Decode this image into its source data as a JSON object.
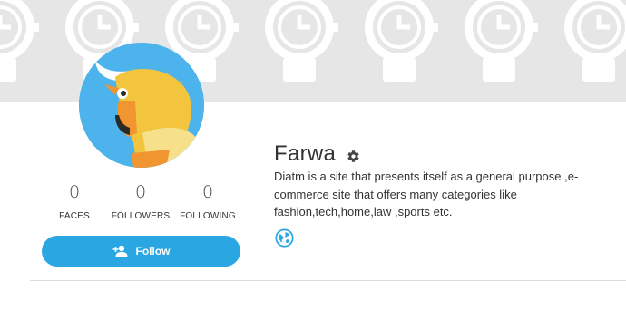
{
  "profile": {
    "name": "Farwa",
    "bio": "Diatm is a site that presents itself as a general purpose ,e-commerce site that offers many categories like fashion,tech,home,law ,sports etc."
  },
  "stats": [
    {
      "value": "0",
      "label": "FACES"
    },
    {
      "value": "0",
      "label": "FOLLOWERS"
    },
    {
      "value": "0",
      "label": "FOLLOWING"
    }
  ],
  "follow": {
    "label": "Follow",
    "icon": "add-person-icon"
  },
  "icons": {
    "settings": "gear-icon",
    "website": "globe-icon",
    "cover_pattern": "watch-icon"
  },
  "colors": {
    "accent": "#2aa7e3",
    "cover": "#e6e6e6",
    "avatar_bg": "#4db3ec",
    "avatar_yellow": "#f3c53f",
    "avatar_orange": "#f0952f"
  }
}
